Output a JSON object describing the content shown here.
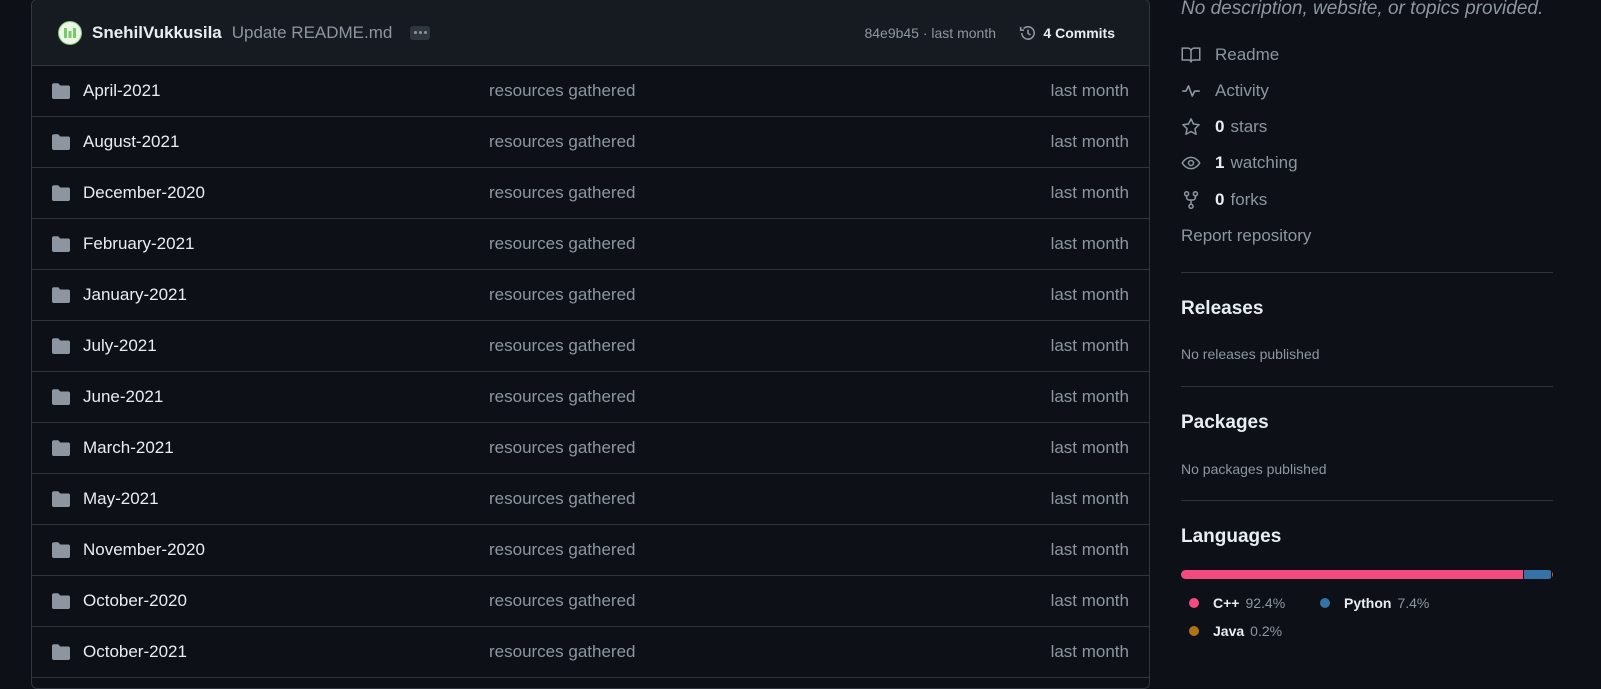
{
  "commit_bar": {
    "author": "SnehilVukkusila",
    "message": "Update README.md",
    "meta": "84e9b45 · last month",
    "commits_label": "4 Commits"
  },
  "files": [
    {
      "name": "April-2021",
      "message": "resources gathered",
      "age": "last month"
    },
    {
      "name": "August-2021",
      "message": "resources gathered",
      "age": "last month"
    },
    {
      "name": "December-2020",
      "message": "resources gathered",
      "age": "last month"
    },
    {
      "name": "February-2021",
      "message": "resources gathered",
      "age": "last month"
    },
    {
      "name": "January-2021",
      "message": "resources gathered",
      "age": "last month"
    },
    {
      "name": "July-2021",
      "message": "resources gathered",
      "age": "last month"
    },
    {
      "name": "June-2021",
      "message": "resources gathered",
      "age": "last month"
    },
    {
      "name": "March-2021",
      "message": "resources gathered",
      "age": "last month"
    },
    {
      "name": "May-2021",
      "message": "resources gathered",
      "age": "last month"
    },
    {
      "name": "November-2020",
      "message": "resources gathered",
      "age": "last month"
    },
    {
      "name": "October-2020",
      "message": "resources gathered",
      "age": "last month"
    },
    {
      "name": "October-2021",
      "message": "resources gathered",
      "age": "last month"
    }
  ],
  "about": {
    "description": "No description, website, or topics provided.",
    "readme": "Readme",
    "activity": "Activity",
    "stars_count": "0",
    "stars_label": "stars",
    "watching_count": "1",
    "watching_label": "watching",
    "forks_count": "0",
    "forks_label": "forks",
    "report": "Report repository"
  },
  "releases": {
    "title": "Releases",
    "empty": "No releases published"
  },
  "packages": {
    "title": "Packages",
    "empty": "No packages published"
  },
  "languages": {
    "title": "Languages",
    "items": [
      {
        "name": "C++",
        "percent": "92.4%",
        "share": 92.4,
        "color": "#f34b7d"
      },
      {
        "name": "Python",
        "percent": "7.4%",
        "share": 7.4,
        "color": "#3572a5"
      },
      {
        "name": "Java",
        "percent": "0.2%",
        "share": 0.2,
        "color": "#b07219"
      }
    ]
  }
}
